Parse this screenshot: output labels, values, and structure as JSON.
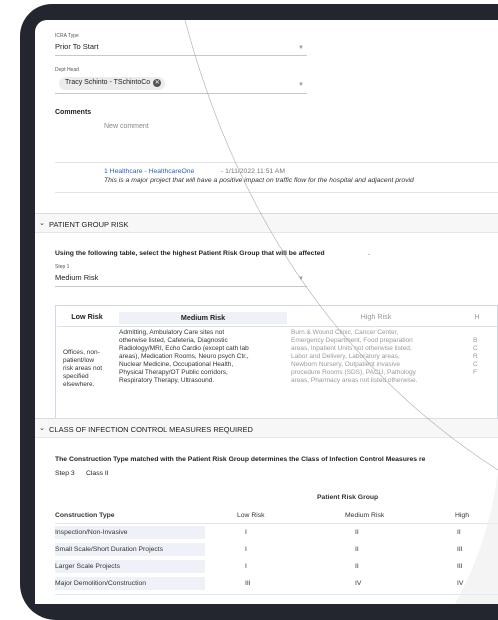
{
  "icra_type": {
    "label": "ICRA Type",
    "value": "Prior To Start"
  },
  "dept_head": {
    "label": "Dept Head",
    "chip": "Tracy Schinto - TSchintoCo",
    "chip_x": "✕"
  },
  "comments": {
    "label": "Comments",
    "placeholder": "New comment",
    "entry_author": "1 Healthcare - HealthcareOne",
    "entry_date": " - 1/11/2022 11:51 AM",
    "entry_text": "This is a major project that will have a positive impact on traffic flow for the hospital and adjacent provid"
  },
  "patient_group": {
    "header": "PATIENT GROUP RISK",
    "instruction_prefix": "Using the following table, select the highest Patient Risk Group that will be affected",
    "instruction_suffix": ".",
    "step_label": "Step 1",
    "step_value": "Medium Risk",
    "columns": {
      "low": {
        "header": "Low Risk",
        "lines": [
          "Offices, non-",
          "patient/low",
          "risk areas not",
          "specified",
          "elsewhere."
        ]
      },
      "medium": {
        "header": "Medium Risk",
        "lines": [
          "Admitting, Ambulatory Care sites not",
          "otherwise listed, Cafeteria, Diagnostic",
          "Radiology/MRI, Echo Cardio (except cath lab",
          "areas), Medication Rooms, Neuro psych Ctr.,",
          "Nuclear Medicine, Occupational Health,",
          "Physical Therapy/OT Public corridors,",
          "Respiratory Therapy, Ultrasound."
        ]
      },
      "high": {
        "header": "High Risk",
        "lines": [
          "Burn & Wound Clinic, Cancer Center,",
          "Emergency Department, Food preparation",
          "areas, Inpatient Units not otherwise listed,",
          "Labor and Delivery, Laboratory areas,",
          "Newborn Nursery, Outpatient invasive",
          "procedure Rooms (SDS), PACU, Pathology",
          "areas, Pharmacy areas not listed otherwise."
        ]
      },
      "highest": {
        "header": "H",
        "lines": [
          "B",
          "C",
          "R",
          "C",
          "F"
        ]
      }
    }
  },
  "infection": {
    "header": "CLASS OF INFECTION CONTROL MEASURES REQUIRED",
    "instruction": "The Construction Type matched with the Patient Risk Group determines the Class of Infection Control Measures re",
    "step_label": "Step 3",
    "step_value": "Class II",
    "group_header": "Patient Risk Group",
    "col_construction": "Construction Type",
    "col_low": "Low Risk",
    "col_medium": "Medium Risk",
    "col_high": "High",
    "rows": [
      {
        "type": "Inspection/Non-Invasive",
        "low": "I",
        "medium": "II",
        "high": "II"
      },
      {
        "type": "Small Scale/Short Duration Projects",
        "low": "I",
        "medium": "II",
        "high": "III"
      },
      {
        "type": "Larger Scale Projects",
        "low": "I",
        "medium": "II",
        "high": "III"
      },
      {
        "type": "Major Demolition/Construction",
        "low": "III",
        "medium": "IV",
        "high": "IV"
      }
    ]
  },
  "colors": {
    "accent": "#2b63c4",
    "frame": "#23262f"
  }
}
